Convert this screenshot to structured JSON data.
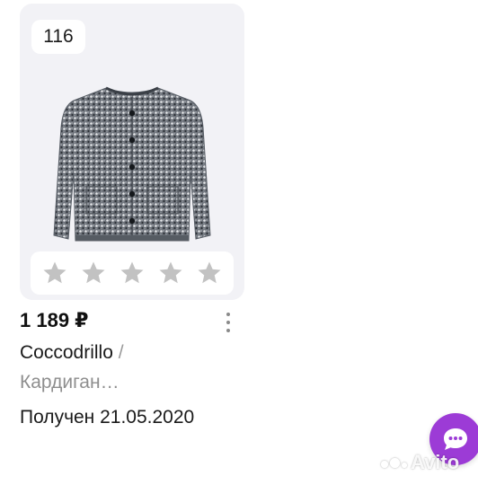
{
  "card": {
    "size_badge": "116",
    "image_icon": "cardigan-photo",
    "rating": {
      "max_stars": 5,
      "filled_stars": 0,
      "star_color": "#c2c2c2"
    }
  },
  "price": "1 189 ₽",
  "brand": "Coccodrillo",
  "brand_separator": "/",
  "title": "Кардиган…",
  "status": "Получен 21.05.2020",
  "more_icon": "more-vertical-icon",
  "chat_button": {
    "icon": "chat-bubble-icon",
    "color": "#9c3bd6"
  },
  "watermark": "Avito",
  "colors": {
    "card_bg": "#f2f2f6",
    "title_gray": "#8e8e8e"
  }
}
